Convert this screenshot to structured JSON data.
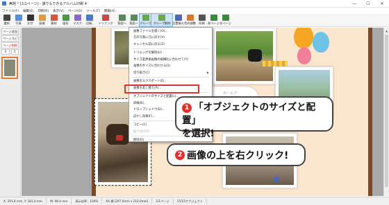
{
  "window": {
    "title": "無題 * [1/1ページ] - 誰でもできるアルバム印刷 4",
    "controls": [
      "—",
      "☐",
      "✕"
    ]
  },
  "menubar": [
    "ファイル(F)",
    "編集(E)",
    "印刷(R)",
    "表示(V)",
    "ページ(G)",
    "ツール(T)",
    "情報(H)"
  ],
  "toolbar": [
    {
      "label": "選択",
      "icon": "cursor-icon",
      "color": "#444444"
    },
    {
      "label": "写真",
      "icon": "photo-icon",
      "color": "#5a8fd8"
    },
    {
      "label": "文字",
      "icon": "text-icon",
      "color": "#333333"
    },
    {
      "label": "画像",
      "icon": "image-icon",
      "color": "#e29a3b"
    },
    {
      "label": "素材",
      "icon": "material-icon",
      "color": "#d8553b"
    },
    {
      "label": "図形",
      "icon": "shape-icon",
      "color": "#4a9a4a"
    },
    {
      "label": "マスク",
      "icon": "mask-icon",
      "color": "#8a6ac8"
    },
    {
      "label": "回転",
      "icon": "rotate-icon",
      "color": "#4a7ac8"
    },
    {
      "label": "トリミング",
      "icon": "trim-icon",
      "color": "#c84a4a"
    },
    {
      "label": "背面へ",
      "icon": "send-back-icon",
      "color": "#5a8a5a"
    },
    {
      "label": "背面へ",
      "icon": "send-backward-icon",
      "color": "#5a8a5a"
    },
    {
      "label": "グループ",
      "icon": "group-icon",
      "color": "#6aa84f"
    },
    {
      "label": "グループ解除",
      "icon": "ungroup-icon",
      "color": "#6aa84f"
    },
    {
      "label": "位置揃え",
      "icon": "align-icon",
      "color": "#4a6ab8"
    },
    {
      "label": "色の調整",
      "icon": "color-adjust-icon",
      "color": "#d87a2c"
    },
    {
      "label": "印刷",
      "icon": "print-icon",
      "color": "#555555"
    },
    {
      "label": "前ページ",
      "icon": "prev-page-icon",
      "color": "#3a8a3a"
    },
    {
      "label": "次ページ",
      "icon": "next-page-icon",
      "color": "#3a8a3a"
    }
  ],
  "leftpanel": {
    "add_page": "ページ追加",
    "copy_page": "ページコピー",
    "delete_page": "ページ削除",
    "thumb_number": "1"
  },
  "context_menu": {
    "items": [
      {
        "label": "画像ファイルを開く(O)...",
        "disabled": false,
        "submenu": false
      },
      {
        "label": "元の写真に元に戻す(V)",
        "disabled": false,
        "submenu": false
      },
      {
        "label": "キャンセル前に戻る(Z)",
        "disabled": false,
        "submenu": false
      },
      {
        "sep": true
      },
      {
        "label": "トリミングを解除(U)",
        "disabled": false,
        "submenu": false
      },
      {
        "label": "サイズ変更後画像の縦横比に合わせて(Y)",
        "disabled": false,
        "submenu": false
      },
      {
        "label": "画像のサイズに合わせる(S)",
        "disabled": false,
        "submenu": false
      },
      {
        "label": "切り抜き(C)",
        "disabled": false,
        "submenu": true
      },
      {
        "sep": true
      },
      {
        "label": "画像をエクスポート(E)...",
        "disabled": false,
        "submenu": false
      },
      {
        "label": "画像を差し替え(R)...",
        "disabled": false,
        "submenu": false
      },
      {
        "sep": true
      },
      {
        "label": "オブジェクトのサイズと配置(L)...",
        "disabled": false,
        "submenu": false
      },
      {
        "label": "枠線(B)...",
        "disabled": false,
        "submenu": false
      },
      {
        "label": "ドロップシャドウ(D)...",
        "disabled": false,
        "submenu": false
      },
      {
        "label": "ぼかし効果(F)...",
        "disabled": false,
        "submenu": false
      },
      {
        "sep": true
      },
      {
        "label": "コピー(C)",
        "disabled": false,
        "submenu": false
      },
      {
        "label": "貼り付け(P)",
        "disabled": true,
        "submenu": false
      },
      {
        "sep": true
      },
      {
        "label": "削除(D)",
        "disabled": false,
        "submenu": false
      }
    ]
  },
  "speech_text": "ボールプ\nリンクして",
  "callout1": {
    "number": "1",
    "line1": "「オブジェクトのサイズと配置」",
    "line2": "を選択!"
  },
  "callout2": {
    "number": "2",
    "text": "画像の上を右クリック!"
  },
  "statusbar": [
    "X: 291.8 mm, Y: 181.0 mm",
    "W: 98.4 mm",
    "表示倍率：100%",
    "A4 横 [297.0mm x 210.0mm]",
    "1/1ページ",
    "15/15オブジェクト"
  ],
  "colors": {
    "page_border": "#7a4a28",
    "page_bg": "#fbe7cf",
    "highlight_red": "#e0312b"
  }
}
